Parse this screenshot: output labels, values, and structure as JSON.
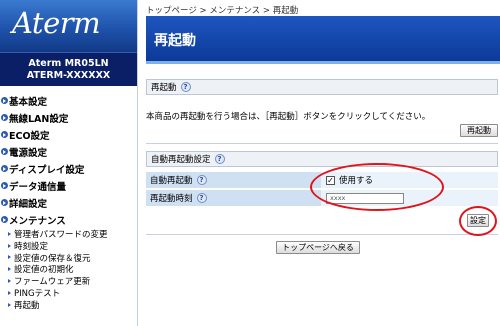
{
  "logo": "Aterm",
  "model": {
    "line1": "Aterm MR05LN",
    "line2": "ATERM-XXXXXX"
  },
  "menu": [
    "基本設定",
    "無線LAN設定",
    "ECO設定",
    "電源設定",
    "ディスプレイ設定",
    "データ通信量",
    "詳細設定",
    "メンテナンス"
  ],
  "submenu": [
    "管理者パスワードの変更",
    "時刻設定",
    "設定値の保存＆復元",
    "設定値の初期化",
    "ファームウェア更新",
    "PINGテスト",
    "再起動"
  ],
  "breadcrumb": "トップページ > メンテナンス > 再起動",
  "page_title": "再起動",
  "reboot": {
    "heading": "再起動",
    "description": "本商品の再起動を行う場合は、［再起動］ボタンをクリックしてください。",
    "button": "再起動"
  },
  "auto_reboot": {
    "heading": "自動再起動設定",
    "enable_label": "自動再起動",
    "enable_value": "使用する",
    "enable_checked": true,
    "time_label": "再起動時刻",
    "time_value": "xxxx",
    "set_button": "設定"
  },
  "help": "?",
  "check_mark": "✓",
  "back_button": "トップページへ戻る",
  "colors": {
    "accent": "#1e56c0",
    "highlight": "#e0141b"
  }
}
